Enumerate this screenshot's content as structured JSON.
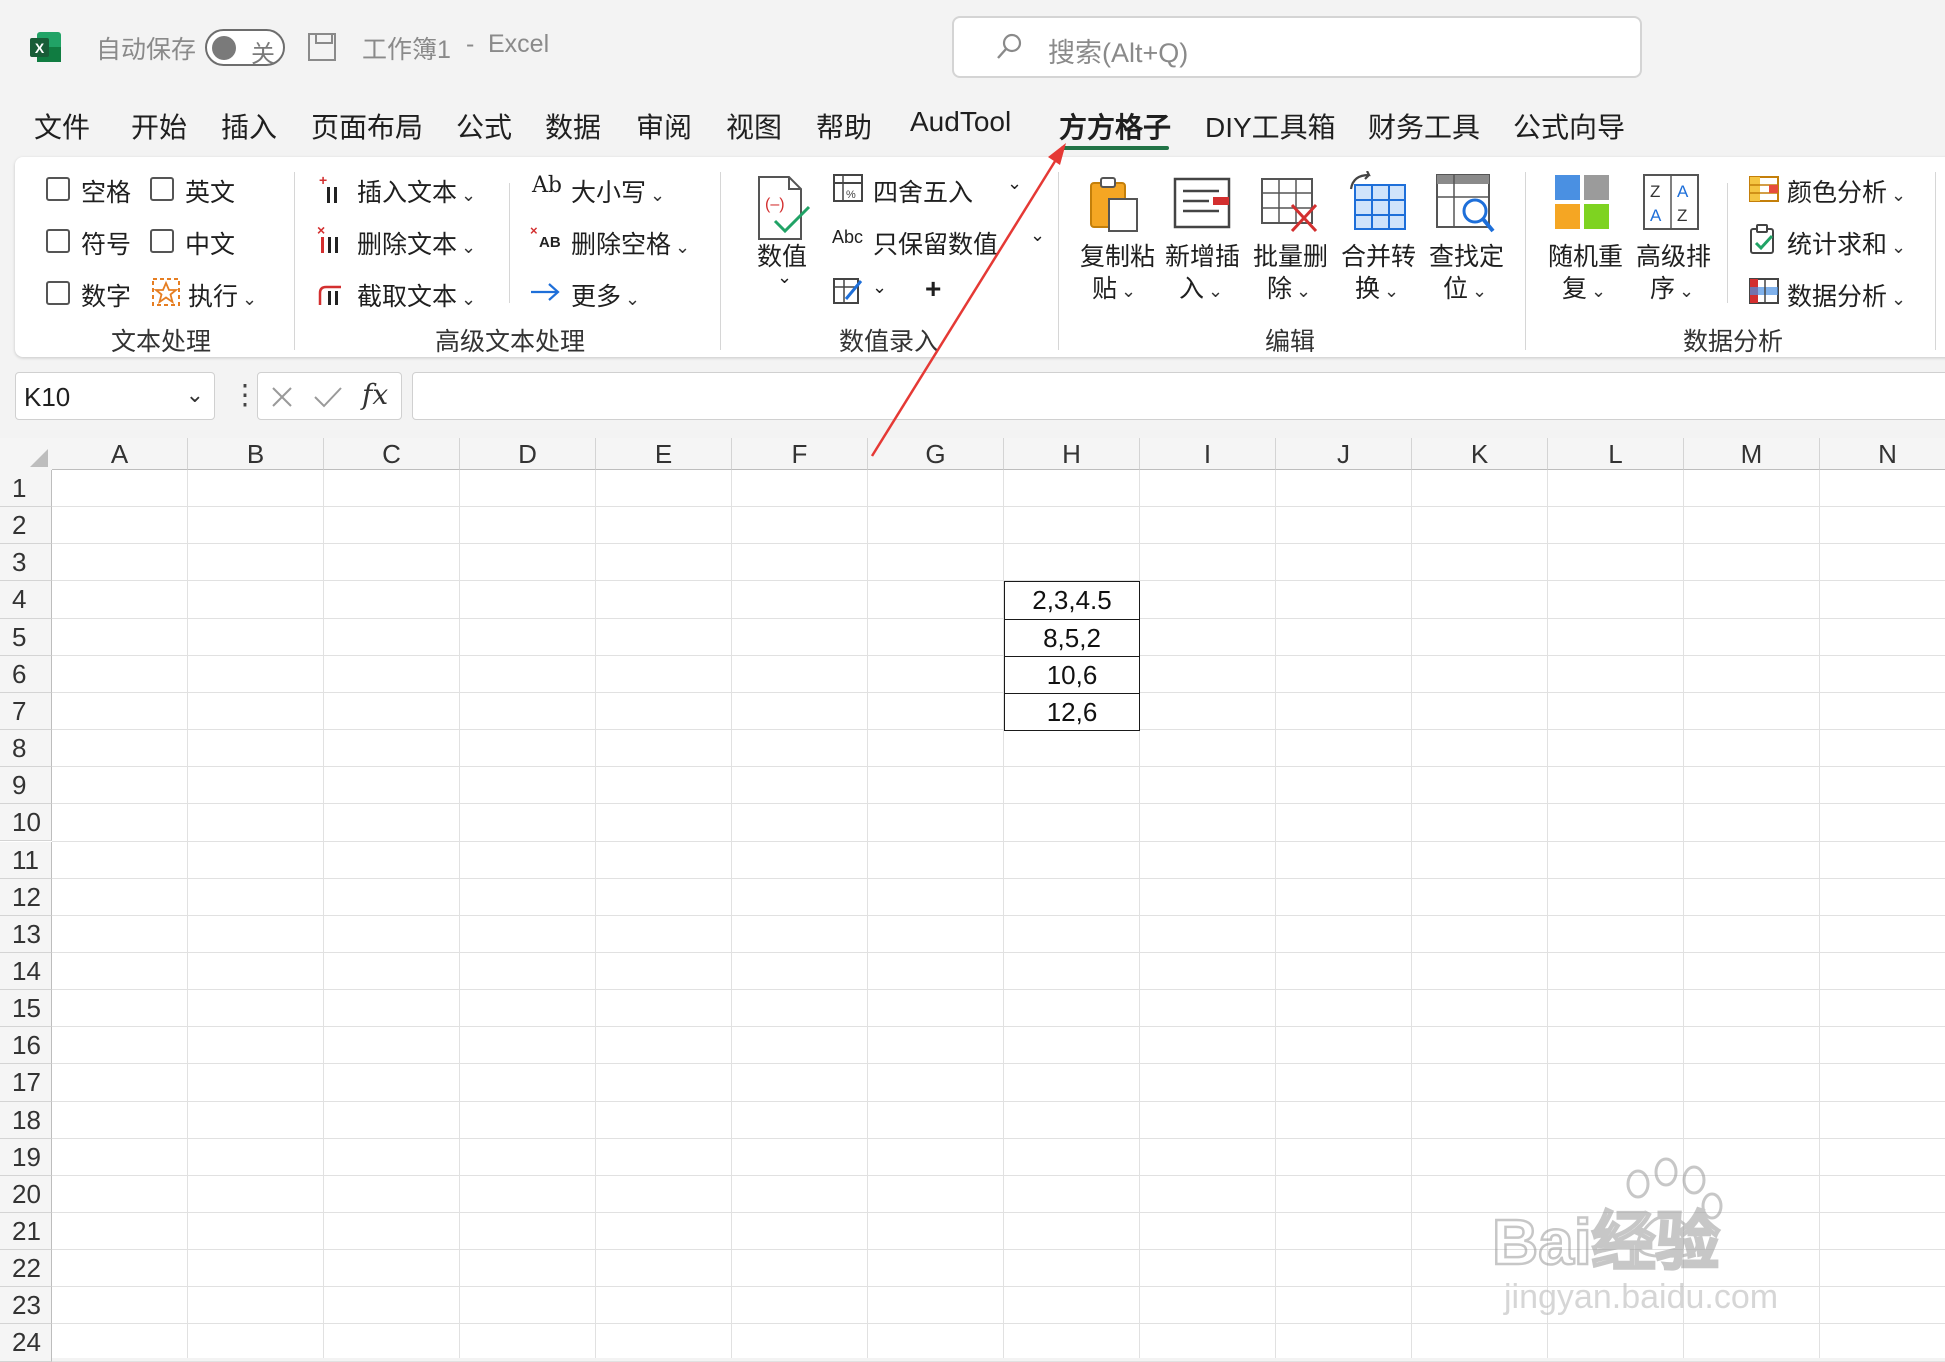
{
  "title_bar": {
    "autosave_label": "自动保存",
    "autosave_state": "关",
    "workbook_title": "工作簿1",
    "separator": "-",
    "app_name": "Excel",
    "search_placeholder": "搜索(Alt+Q)"
  },
  "menu": {
    "items": [
      "文件",
      "开始",
      "插入",
      "页面布局",
      "公式",
      "数据",
      "审阅",
      "视图",
      "帮助",
      "AudTool",
      "方方格子",
      "DIY工具箱",
      "财务工具",
      "公式向导"
    ],
    "active_index": 10
  },
  "ribbon": {
    "text_processing": {
      "checkboxes": [
        "空格",
        "英文",
        "符号",
        "中文",
        "数字"
      ],
      "execute_label": "执行",
      "group_label": "文本处理"
    },
    "advanced_text": {
      "insert_text": "插入文本",
      "delete_text": "删除文本",
      "extract_text": "截取文本",
      "case_label": "大小写",
      "delete_spaces": "删除空格",
      "more_label": "更多",
      "group_label": "高级文本处理"
    },
    "value_entry": {
      "value_label": "数值",
      "round_label": "四舍五入",
      "keep_values": "只保留数值",
      "group_label": "数值录入"
    },
    "edit": {
      "buttons": [
        {
          "line1": "复制粘",
          "line2": "贴"
        },
        {
          "line1": "新增插",
          "line2": "入"
        },
        {
          "line1": "批量删",
          "line2": "除"
        },
        {
          "line1": "合并转",
          "line2": "换"
        },
        {
          "line1": "查找定",
          "line2": "位"
        }
      ],
      "group_label": "编辑"
    },
    "data_analysis": {
      "random_dup": {
        "line1": "随机重",
        "line2": "复"
      },
      "adv_sort": {
        "line1": "高级排",
        "line2": "序"
      },
      "color_analysis": "颜色分析",
      "stat_sum": "统计求和",
      "data_analysis": "数据分析",
      "group_label": "数据分析"
    }
  },
  "formula_bar": {
    "name_box": "K10",
    "fx_label": "fx",
    "formula_value": ""
  },
  "sheet": {
    "columns": [
      "A",
      "B",
      "C",
      "D",
      "E",
      "F",
      "G",
      "H",
      "I",
      "J",
      "K",
      "L",
      "M",
      "N"
    ],
    "rows": [
      "1",
      "2",
      "3",
      "4",
      "5",
      "6",
      "7",
      "8",
      "9",
      "10",
      "11",
      "12",
      "13",
      "14",
      "15",
      "16",
      "17",
      "18",
      "19",
      "20",
      "21",
      "22",
      "23",
      "24"
    ],
    "cells": [
      {
        "ref": "H4",
        "value": "2,3,4.5"
      },
      {
        "ref": "H5",
        "value": "8,5,2"
      },
      {
        "ref": "H6",
        "value": "10,6"
      },
      {
        "ref": "H7",
        "value": "12,6"
      }
    ]
  },
  "watermark": {
    "brand": "Bai经验",
    "url": "jingyan.baidu.com"
  },
  "colors": {
    "excel_green": "#217346",
    "arrow_red": "#e53935"
  }
}
